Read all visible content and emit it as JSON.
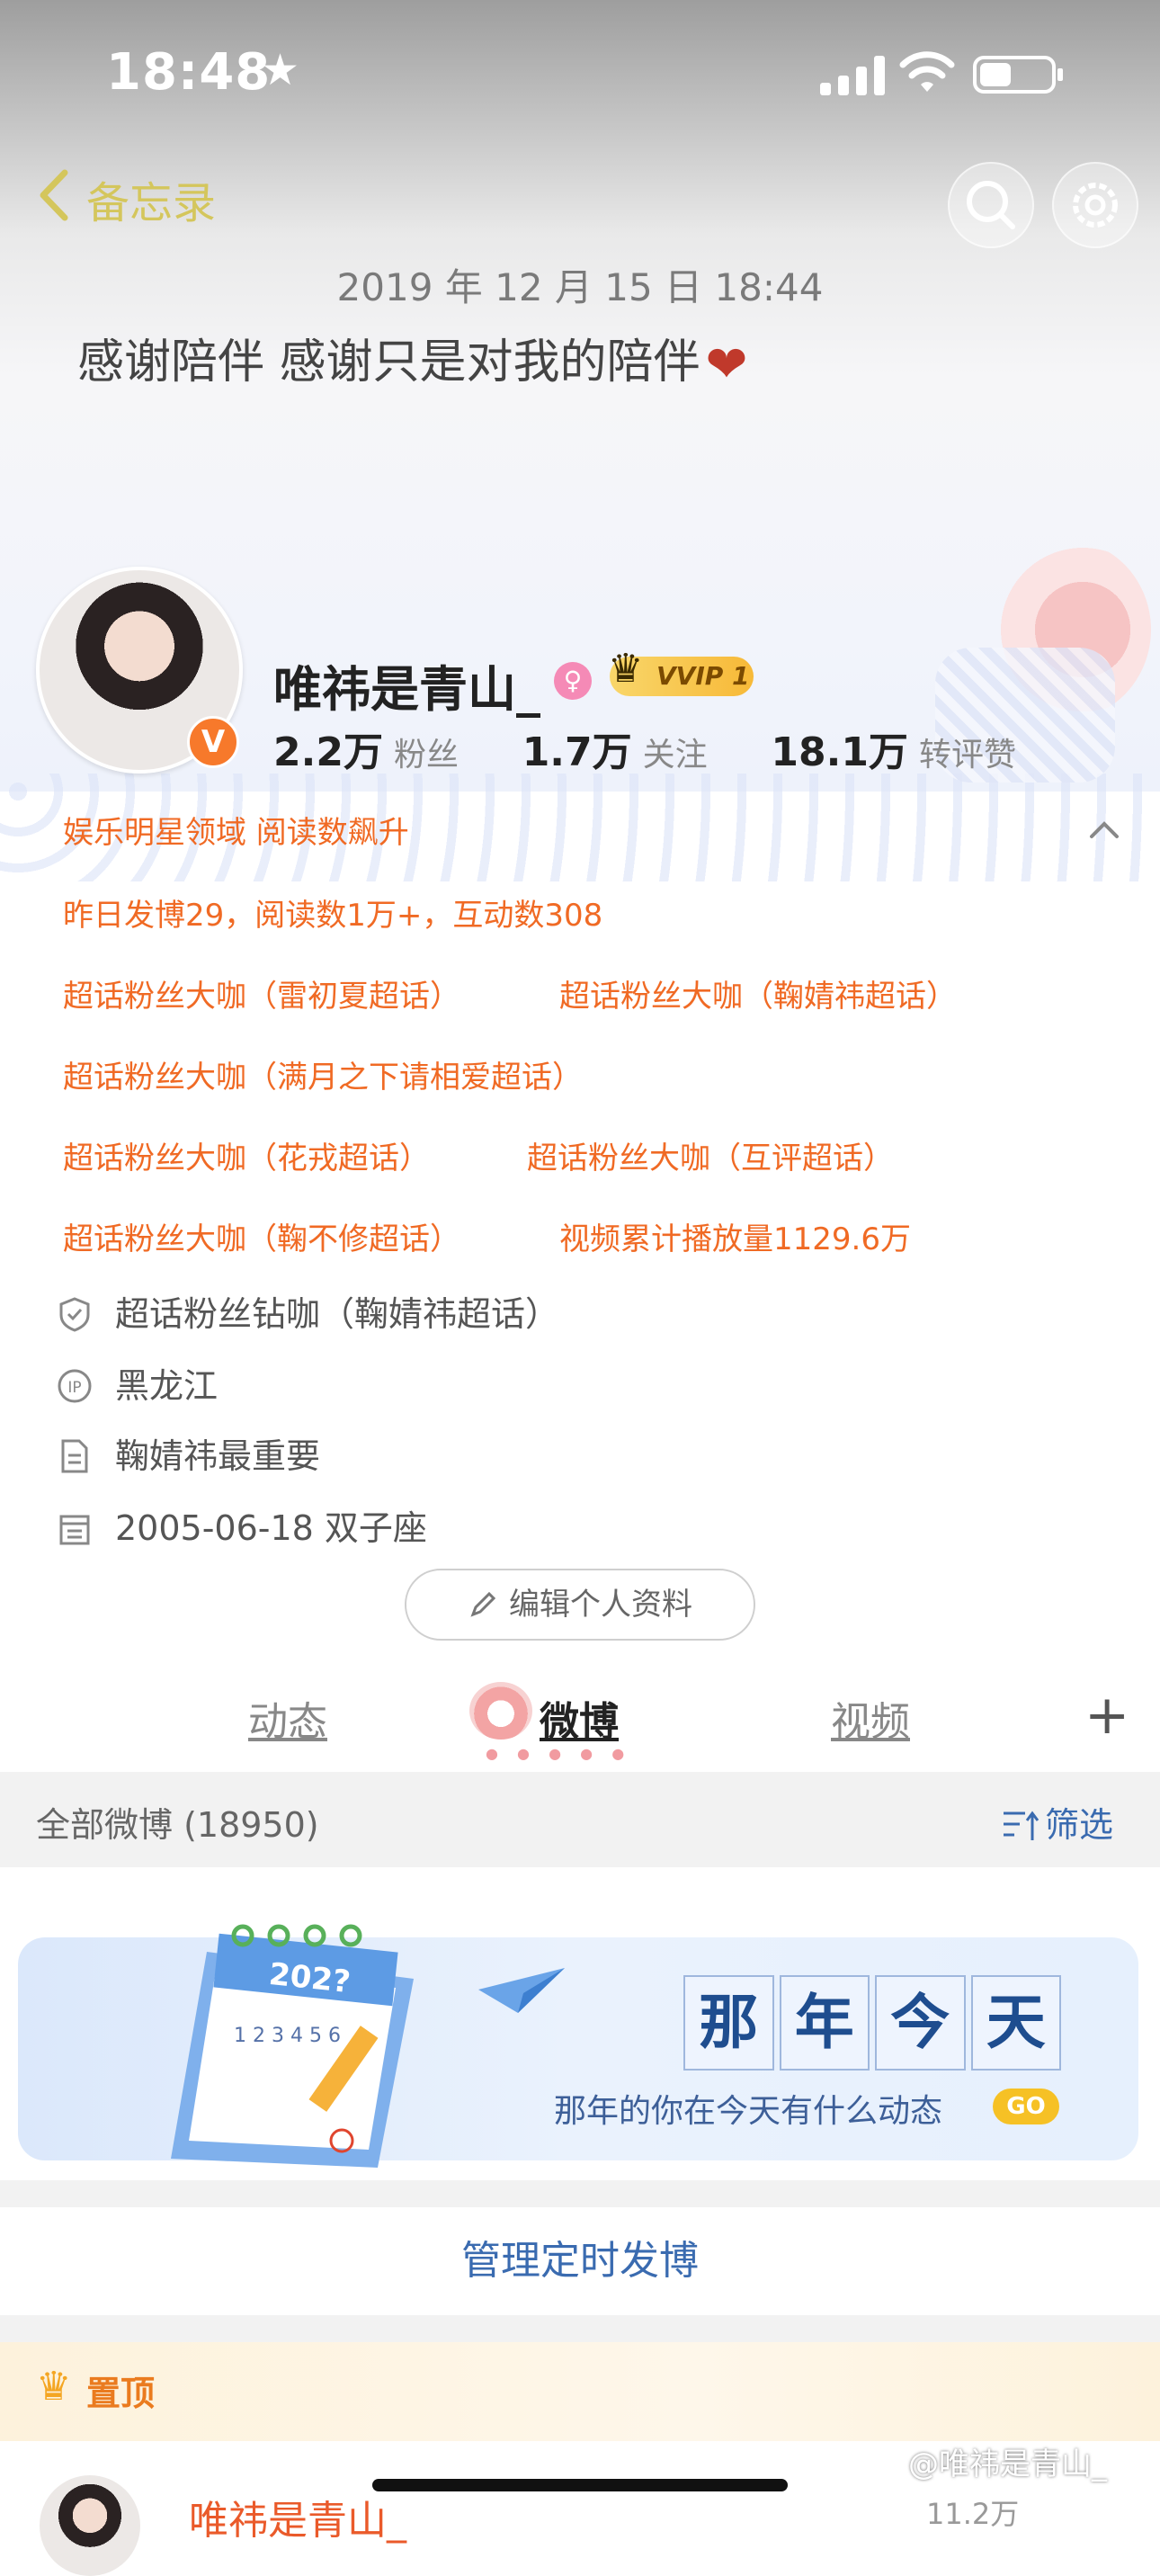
{
  "status_bar": {
    "time": "18:48",
    "star": "★"
  },
  "nav": {
    "back_label": "备忘录"
  },
  "memo": {
    "date": "2019 年 12 月 15 日 18:44",
    "text": "感谢陪伴 感谢只是对我的陪伴",
    "emoji": "❤"
  },
  "profile": {
    "username": "唯祎是青山_",
    "verified_badge": "V",
    "gender_symbol": "♀",
    "vip_label": "VVIP 1",
    "stats": [
      {
        "value": "2.2万",
        "label": "粉丝"
      },
      {
        "value": "1.7万",
        "label": "关注"
      },
      {
        "value": "18.1万",
        "label": "转评赞"
      }
    ]
  },
  "badges": {
    "field": "娱乐明星领域 阅读数飙升",
    "yesterday": "昨日发博29，阅读数1万+，互动数308",
    "rows": [
      [
        "超话粉丝大咖（雷初夏超话）",
        "超话粉丝大咖（鞠婧祎超话）"
      ],
      [
        "超话粉丝大咖（满月之下请相爱超话）",
        ""
      ],
      [
        "超话粉丝大咖（花戎超话）",
        "超话粉丝大咖（互评超话）"
      ],
      [
        "超话粉丝大咖（鞠不修超话）",
        "视频累计播放量1129.6万"
      ]
    ]
  },
  "info": {
    "diamond": "超话粉丝钻咖（鞠婧祎超话）",
    "location": "黑龙江",
    "bio": "鞠婧祎最重要",
    "birthday": "2005-06-18 双子座"
  },
  "edit_profile_label": "编辑个人资料",
  "tabs": [
    {
      "label": "动态",
      "active": false
    },
    {
      "label": "微博",
      "active": true
    },
    {
      "label": "视频",
      "active": false
    }
  ],
  "tab_add": "+",
  "list": {
    "title": "全部微博 (18950)",
    "filter_label": "筛选"
  },
  "banner": {
    "year": "202?",
    "calendar_numbers": "1 2 3 4 5 6",
    "title_chars": [
      "那",
      "年",
      "今",
      "天"
    ],
    "subtitle": "那年的你在今天有什么动态",
    "go_label": "GO"
  },
  "manage_label": "管理定时发博",
  "pinned": {
    "label": "置顶",
    "post_author": "唯祎是青山_",
    "post_count": "11.2万"
  },
  "watermark": "@唯祎是青山_",
  "colors": {
    "accent_orange": "#f06a24",
    "link_blue": "#3a6bb0",
    "vip_gold": "#f7b938"
  }
}
